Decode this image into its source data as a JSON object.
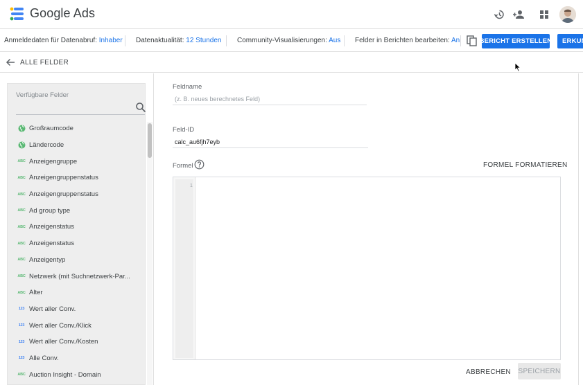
{
  "header": {
    "app_title": "Google Ads",
    "icons": [
      "history-icon",
      "person-add-icon",
      "apps-grid-icon",
      "avatar"
    ]
  },
  "infobar": {
    "credentials_label": "Anmeldedaten für Datenabruf:",
    "credentials_value": "Inhaber",
    "freshness_label": "Datenaktualität:",
    "freshness_value": "12 Stunden",
    "community_label": "Community-Visualisierungen:",
    "community_value": "Aus",
    "edit_fields_label": "Felder in Berichten bearbeiten:",
    "edit_fields_value": "An",
    "create_report_button": "BERICHT ERSTELLEN",
    "explore_button": "ERKUNDEN"
  },
  "backrow": {
    "label": "ALLE FELDER"
  },
  "left_panel": {
    "title": "Verfügbare Felder",
    "search_placeholder": "",
    "fields": [
      {
        "label": "Großraumcode",
        "type": "geo"
      },
      {
        "label": "Ländercode",
        "type": "geo"
      },
      {
        "label": "Anzeigengruppe",
        "type": "text"
      },
      {
        "label": "Anzeigengruppenstatus",
        "type": "text"
      },
      {
        "label": "Anzeigengruppenstatus",
        "type": "text"
      },
      {
        "label": "Ad group type",
        "type": "text"
      },
      {
        "label": "Anzeigenstatus",
        "type": "text"
      },
      {
        "label": "Anzeigenstatus",
        "type": "text"
      },
      {
        "label": "Anzeigentyp",
        "type": "text"
      },
      {
        "label": "Netzwerk (mit Suchnetzwerk-Par...",
        "type": "text"
      },
      {
        "label": "Alter",
        "type": "text"
      },
      {
        "label": "Wert aller Conv.",
        "type": "number"
      },
      {
        "label": "Wert aller Conv./Klick",
        "type": "number"
      },
      {
        "label": "Wert aller Conv./Kosten",
        "type": "number"
      },
      {
        "label": "Alle Conv.",
        "type": "number"
      },
      {
        "label": "Auction Insight - Domain",
        "type": "text"
      }
    ],
    "icon_text": {
      "text": "ABC",
      "number": "123"
    }
  },
  "form": {
    "fieldname_label": "Feldname",
    "fieldname_placeholder": "(z. B. neues berechnetes Feld)",
    "fieldid_label": "Feld-ID",
    "fieldid_value": "calc_au6fjh7eyb",
    "formula_label": "Formel",
    "format_formula": "FORMEL FORMATIEREN",
    "editor_line_number": "1",
    "cancel_button": "ABBRECHEN",
    "save_button": "SPEICHERN"
  },
  "colors": {
    "accent": "#1a73e8",
    "geo_icon": "#5bb974",
    "text_icon": "#5bb974",
    "number_icon": "#4285f4"
  }
}
